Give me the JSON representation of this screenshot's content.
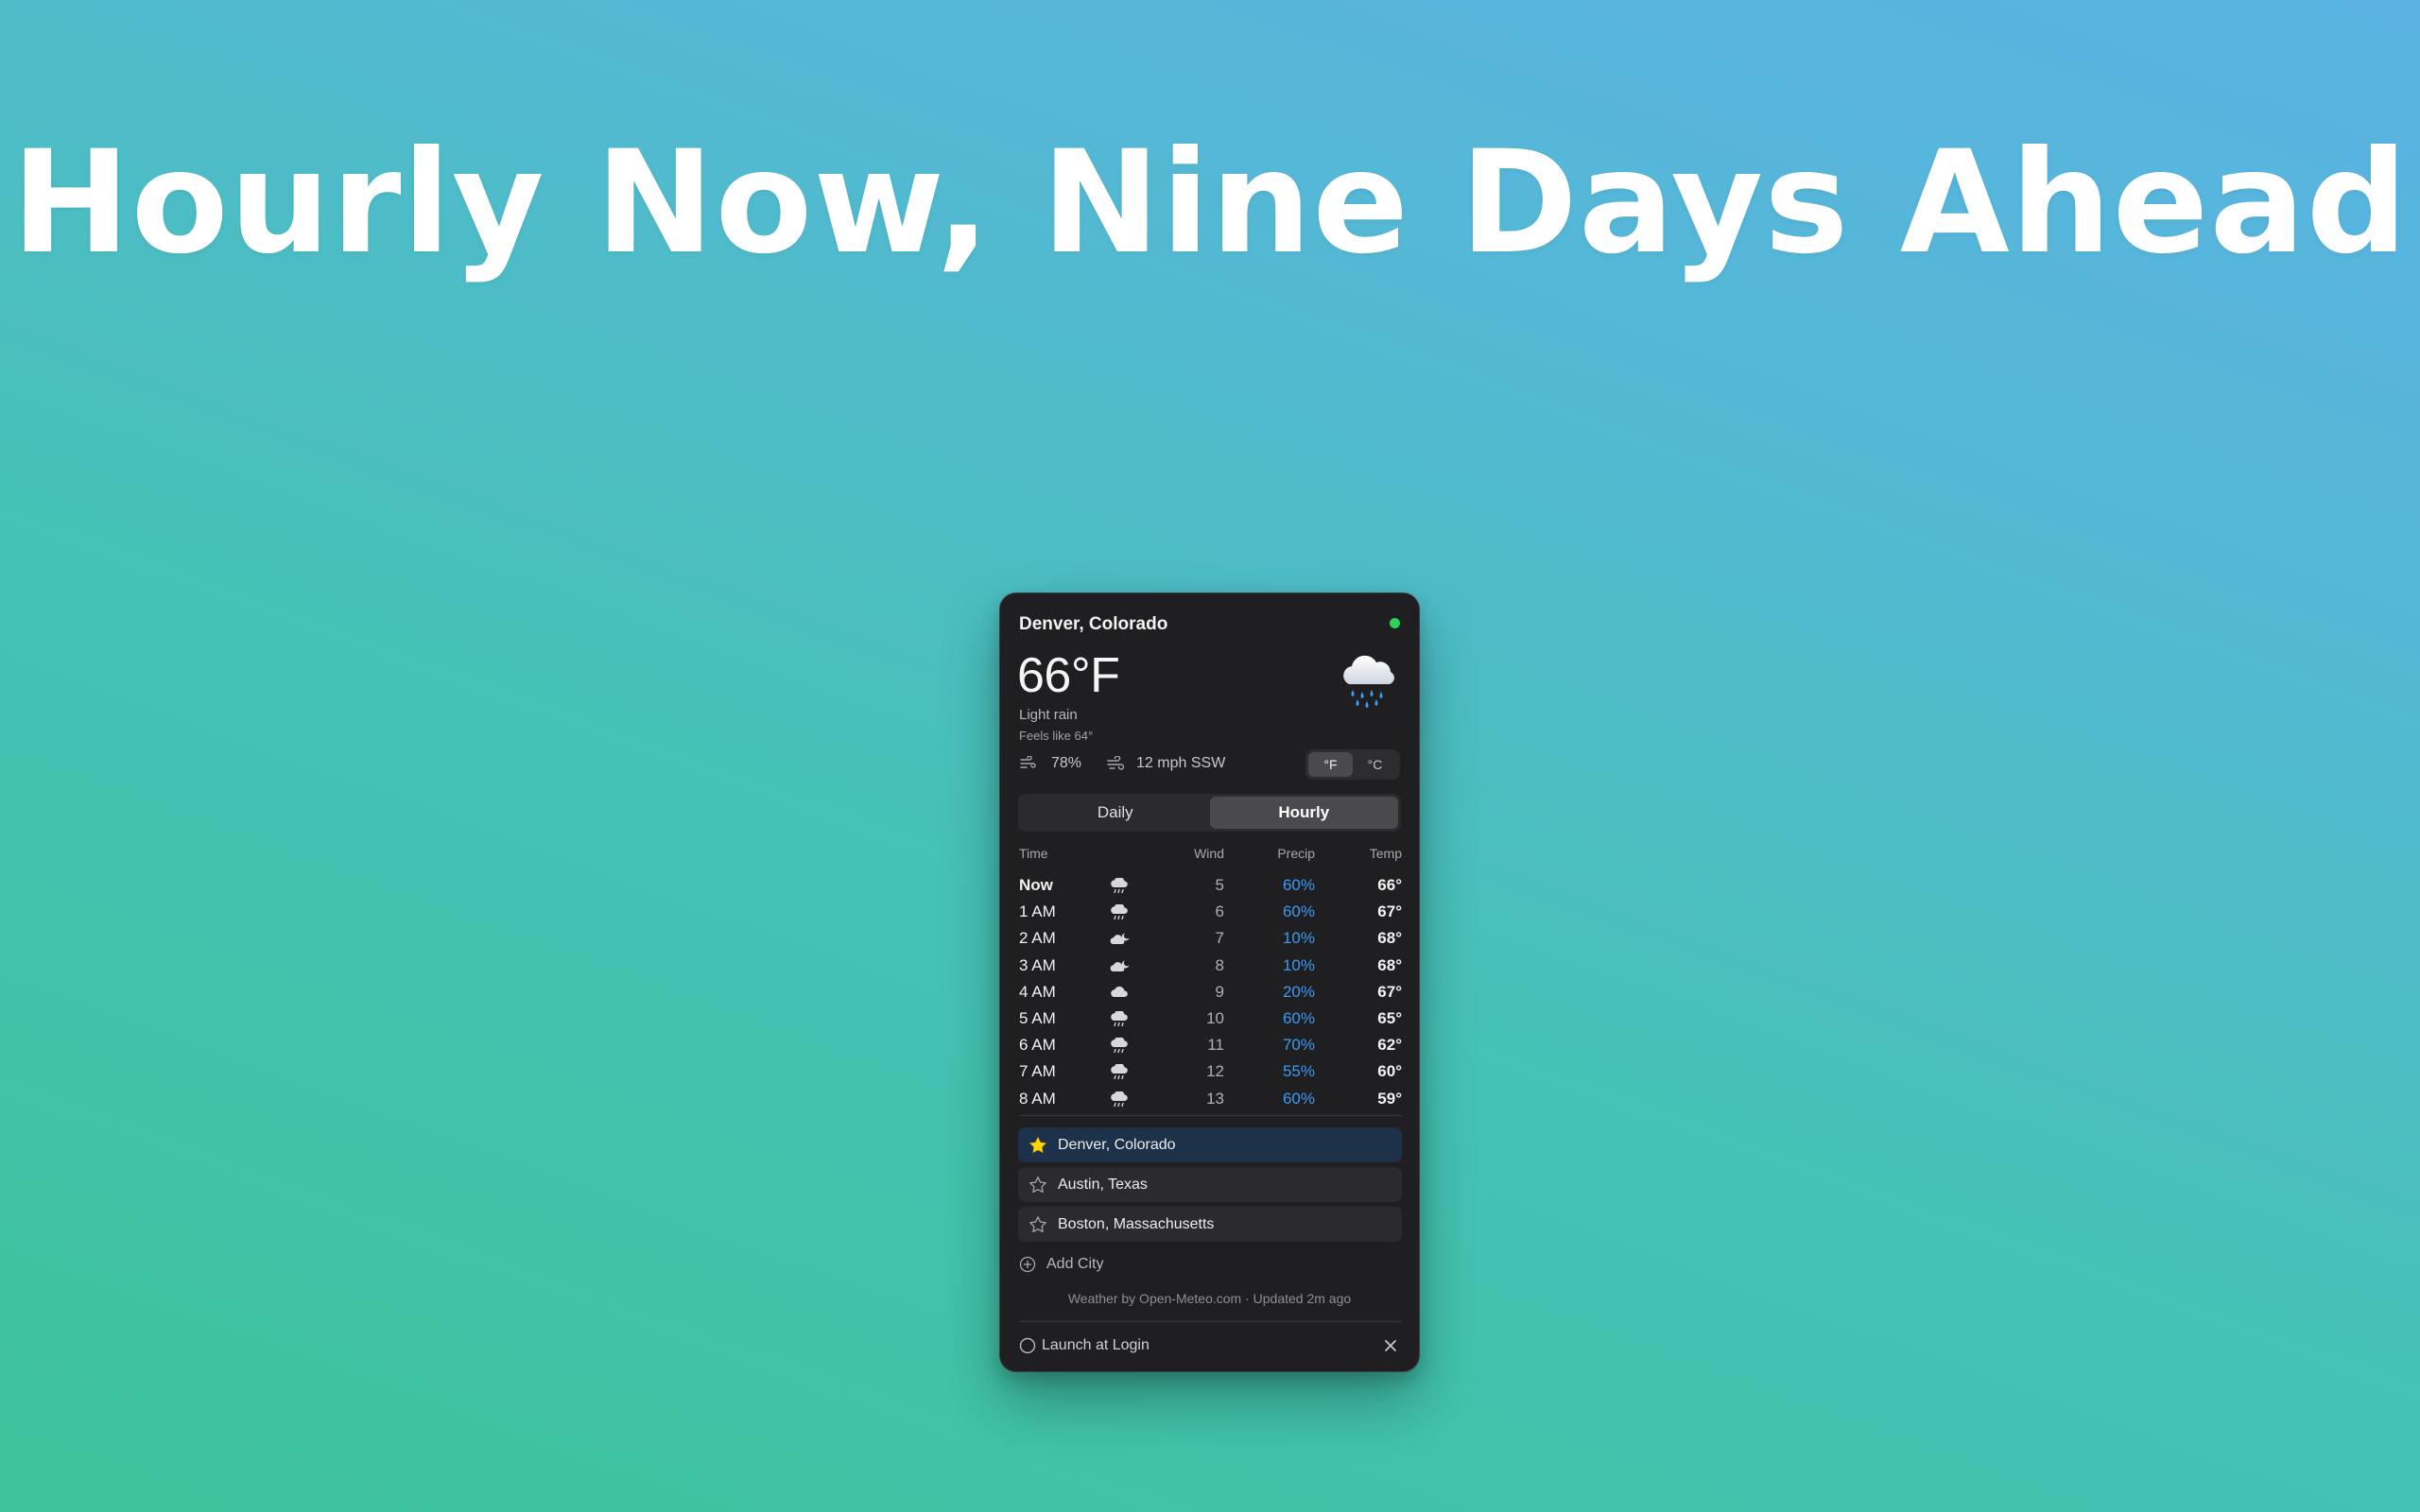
{
  "headline": "Hourly Now, Nine Days Ahead",
  "panel": {
    "city": "Denver, Colorado",
    "status_color": "#30d158",
    "temperature": "66°F",
    "condition": "Light rain",
    "feels_like": "Feels like 64°",
    "humidity": "78%",
    "wind": "12 mph SSW",
    "condition_icon": "rain-cloud-icon",
    "units": {
      "fahrenheit": "°F",
      "celsius": "°C",
      "selected": "°F"
    },
    "tabs": {
      "daily": "Daily",
      "hourly": "Hourly",
      "selected": "Hourly"
    },
    "table": {
      "headers": {
        "time": "Time",
        "wind": "Wind",
        "precip": "Precip",
        "temp": "Temp"
      },
      "rows": [
        {
          "time": "Now",
          "icon": "rain-icon",
          "wind": "5",
          "precip": "60%",
          "temp": "66°"
        },
        {
          "time": "1 AM",
          "icon": "rain-icon",
          "wind": "6",
          "precip": "60%",
          "temp": "67°"
        },
        {
          "time": "2 AM",
          "icon": "cloud-moon-icon",
          "wind": "7",
          "precip": "10%",
          "temp": "68°"
        },
        {
          "time": "3 AM",
          "icon": "cloud-moon-icon",
          "wind": "8",
          "precip": "10%",
          "temp": "68°"
        },
        {
          "time": "4 AM",
          "icon": "cloud-icon",
          "wind": "9",
          "precip": "20%",
          "temp": "67°"
        },
        {
          "time": "5 AM",
          "icon": "rain-icon",
          "wind": "10",
          "precip": "60%",
          "temp": "65°"
        },
        {
          "time": "6 AM",
          "icon": "rain-icon",
          "wind": "11",
          "precip": "70%",
          "temp": "62°"
        },
        {
          "time": "7 AM",
          "icon": "rain-icon",
          "wind": "12",
          "precip": "55%",
          "temp": "60°"
        },
        {
          "time": "8 AM",
          "icon": "rain-icon",
          "wind": "13",
          "precip": "60%",
          "temp": "59°"
        }
      ]
    },
    "cities": [
      {
        "name": "Denver, Colorado",
        "favorite": true
      },
      {
        "name": "Austin, Texas",
        "favorite": false
      },
      {
        "name": "Boston, Massachusetts",
        "favorite": false
      }
    ],
    "add_city": "Add City",
    "attribution": "Weather by Open-Meteo.com · Updated 2m ago",
    "launch_at_login": "Launch at Login",
    "colors": {
      "precip": "#3a9bf5",
      "favorite_star": "#ffd60a",
      "active_city_bg": "#1d3148"
    }
  }
}
